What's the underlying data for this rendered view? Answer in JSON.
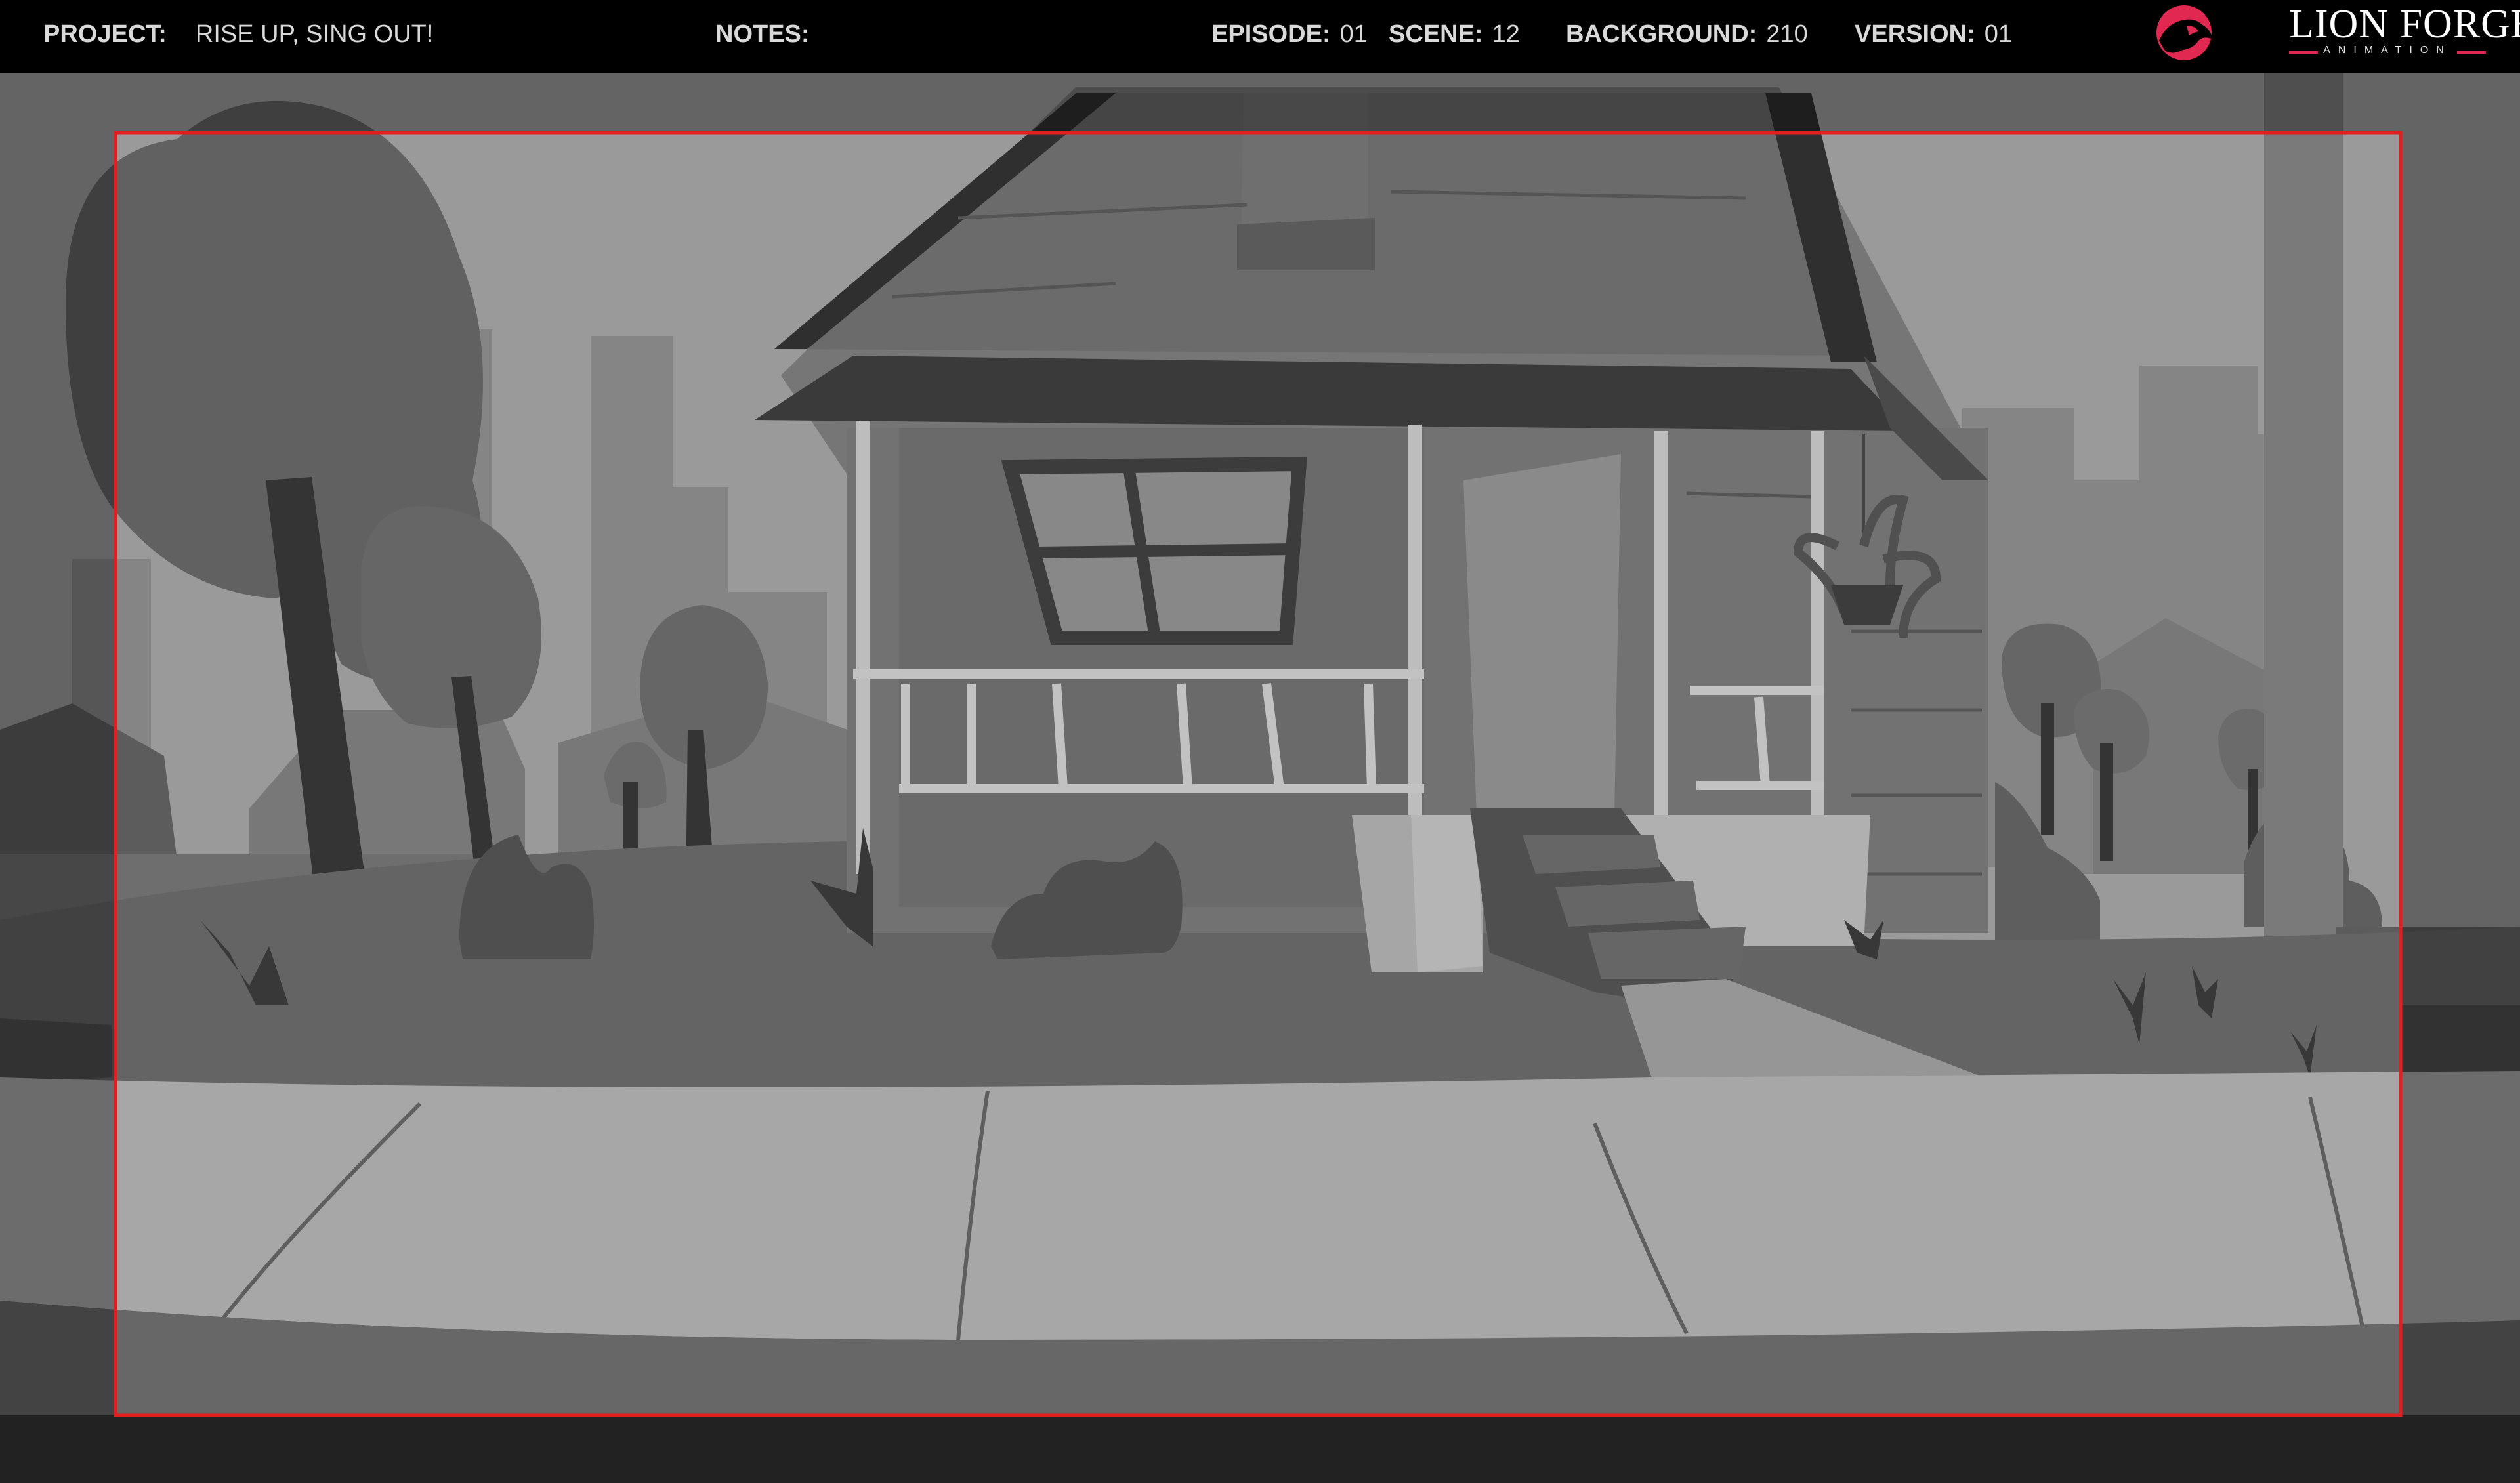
{
  "header": {
    "project_label": "PROJECT:",
    "project_value": "RISE UP, SING OUT!",
    "notes_label": "NOTES:",
    "episode_label": "EPISODE:",
    "episode_value": "01",
    "scene_label": "SCENE:",
    "scene_value": "12",
    "background_label": "BACKGROUND:",
    "background_value": "210",
    "version_label": "VERSION:",
    "version_value": "01"
  },
  "logo": {
    "name": "LION FORGE",
    "subtitle": "ANIMATION",
    "icon": "lion-head-icon"
  },
  "colors": {
    "header_bg": "#000000",
    "header_text": "#d9d9d9",
    "logo_accent": "#e02851",
    "safe_frame": "#e02020",
    "sky": "#9a9a9a",
    "sidewalk": "#a7a7a7",
    "lawn": "#646464",
    "dark": "#333333"
  },
  "scene": {
    "frame": "safe-frame-red",
    "description_icons": [
      "house",
      "tree",
      "bush",
      "hanging-plant",
      "sidewalk",
      "steps"
    ]
  }
}
